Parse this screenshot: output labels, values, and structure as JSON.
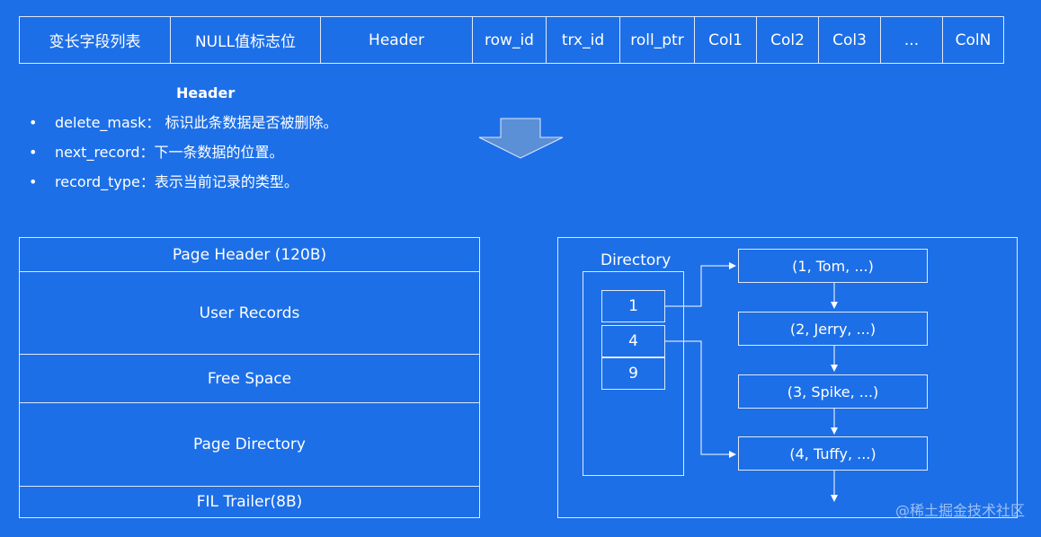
{
  "record_row": {
    "fields": [
      {
        "label": "变长字段列表",
        "name": "field-variable-length-list"
      },
      {
        "label": "NULL值标志位",
        "name": "field-null-flags"
      },
      {
        "label": "Header",
        "name": "field-header"
      },
      {
        "label": "row_id",
        "name": "field-row-id"
      },
      {
        "label": "trx_id",
        "name": "field-trx-id"
      },
      {
        "label": "roll_ptr",
        "name": "field-roll-ptr"
      },
      {
        "label": "Col1",
        "name": "field-col1"
      },
      {
        "label": "Col2",
        "name": "field-col2"
      },
      {
        "label": "Col3",
        "name": "field-col3"
      },
      {
        "label": "...",
        "name": "field-ellipsis"
      },
      {
        "label": "ColN",
        "name": "field-coln"
      }
    ]
  },
  "header_section": {
    "title": "Header",
    "items": [
      "delete_mask： 标识此条数据是否被删除。",
      "next_record：下一条数据的位置。",
      "record_type：表示当前记录的类型。"
    ]
  },
  "page_structure": {
    "segments": [
      "Page Header (120B)",
      "User Records",
      "Free Space",
      "Page Directory",
      "FIL Trailer(8B)"
    ]
  },
  "directory": {
    "label": "Directory",
    "slots": [
      "1",
      "4",
      "9"
    ],
    "records": [
      "(1, Tom, ...)",
      "(2, Jerry, ...)",
      "(3, Spike, ...)",
      "(4, Tuffy, ...)"
    ]
  },
  "watermark": "@稀土掘金技术社区",
  "colors": {
    "background": "#1d6fe7",
    "line": "#dfe9fb",
    "arrow_fill": "#5b8fd6"
  }
}
